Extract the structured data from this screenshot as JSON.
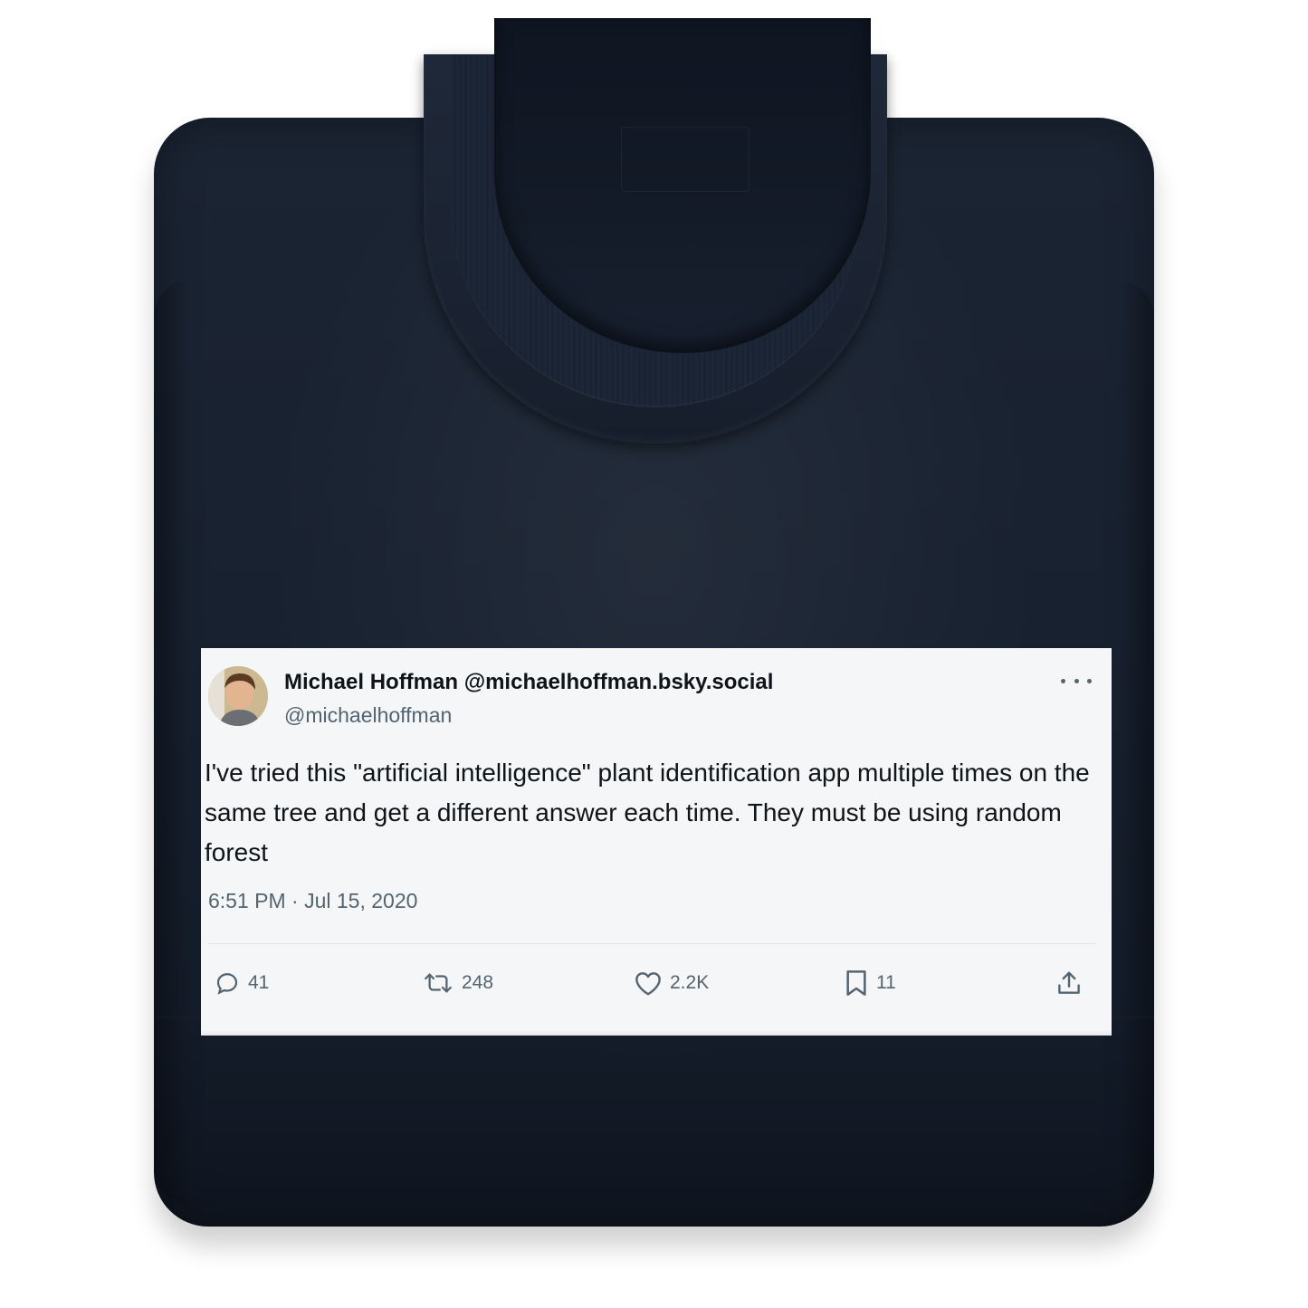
{
  "product": {
    "garment": "sweatshirt",
    "color": "#182130"
  },
  "tweet": {
    "display_name_line": "Michael Hoffman @michaelhoffman.bsky.social",
    "handle": "@michaelhoffman",
    "text": "I've tried this \"artificial intelligence\" plant identification app multiple times on the same tree and get a different answer each time. They must be using random forest",
    "timestamp": "6:51 PM · Jul 15, 2020",
    "actions": {
      "replies": "41",
      "retweets": "248",
      "likes": "2.2K",
      "bookmarks": "11"
    },
    "icons": {
      "more": "more-icon",
      "reply": "reply-icon",
      "retweet": "retweet-icon",
      "like": "heart-icon",
      "bookmark": "bookmark-icon",
      "share": "share-icon"
    }
  }
}
